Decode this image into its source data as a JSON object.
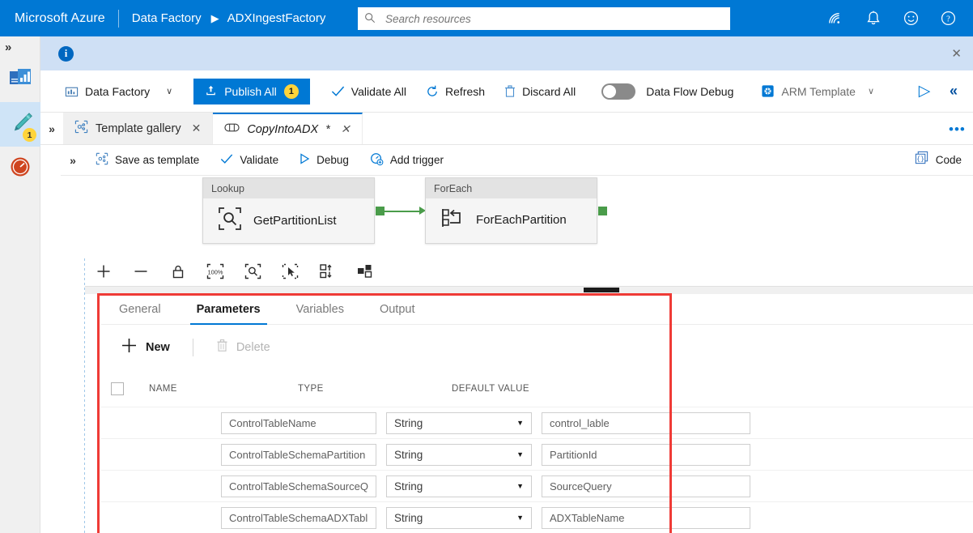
{
  "header": {
    "brand": "Microsoft Azure",
    "breadcrumb_service": "Data Factory",
    "breadcrumb_caret": "▶",
    "breadcrumb_resource": "ADXIngestFactory",
    "search_placeholder": "Search resources",
    "icons": [
      "cloud-shell-icon",
      "notifications-bell-icon",
      "feedback-smiley-icon",
      "help-question-icon"
    ]
  },
  "rail": {
    "expand_glyph": "»",
    "items": [
      {
        "name": "home-overview",
        "badge": ""
      },
      {
        "name": "author-pencil",
        "badge": "1"
      },
      {
        "name": "monitor-gauge",
        "badge": ""
      }
    ]
  },
  "info_bar": {
    "icon": "i",
    "close": "✕"
  },
  "toolbar": {
    "factory_label": "Data Factory",
    "factory_chevron": "∨",
    "publish_label": "Publish All",
    "publish_count": "1",
    "validate_all_label": "Validate All",
    "refresh_label": "Refresh",
    "discard_all_label": "Discard All",
    "data_flow_debug_label": "Data Flow Debug",
    "data_flow_debug_state": "off",
    "arm_template_label": "ARM Template",
    "arm_chevron": "∨",
    "run_glyph": "▷",
    "collapse_glyph": "«"
  },
  "tabs": {
    "expand_glyph": "»",
    "items": [
      {
        "label": "Template gallery",
        "icon": "template-gallery-icon",
        "active": false,
        "dirty": "",
        "close": "✕"
      },
      {
        "label": "CopyIntoADX",
        "icon": "pipeline-icon",
        "active": true,
        "dirty": "*",
        "close": "✕"
      }
    ]
  },
  "pipeline_toolbar": {
    "expand_glyph": "»",
    "save_as_template_label": "Save as template",
    "validate_label": "Validate",
    "debug_label": "Debug",
    "add_trigger_label": "Add trigger",
    "more_glyph": "•••",
    "code_label": "Code"
  },
  "canvas": {
    "activities": [
      {
        "type": "Lookup",
        "name": "GetPartitionList",
        "icon": "lookup-magnifier-icon"
      },
      {
        "type": "ForEach",
        "name": "ForEachPartition",
        "icon": "foreach-loop-icon"
      }
    ],
    "zoom_controls": [
      "zoom-in-icon",
      "zoom-out-icon",
      "lock-icon",
      "zoom-100-percent-icon",
      "zoom-to-fit-icon",
      "select-mode-icon",
      "auto-align-icon",
      "grouping-icon"
    ]
  },
  "properties_panel": {
    "tabs": [
      {
        "label": "General",
        "active": false
      },
      {
        "label": "Parameters",
        "active": true
      },
      {
        "label": "Variables",
        "active": false
      },
      {
        "label": "Output",
        "active": false
      }
    ],
    "new_label": "New",
    "delete_label": "Delete",
    "delete_disabled": true,
    "columns": [
      "NAME",
      "TYPE",
      "DEFAULT VALUE"
    ],
    "rows": [
      {
        "name": "ControlTableName",
        "type": "String",
        "default": "control_lable"
      },
      {
        "name": "ControlTableSchemaPartition",
        "type": "String",
        "default": "PartitionId"
      },
      {
        "name": "ControlTableSchemaSourceQ",
        "type": "String",
        "default": "SourceQuery"
      },
      {
        "name": "ControlTableSchemaADXTabl",
        "type": "String",
        "default": "ADXTableName"
      }
    ]
  },
  "colors": {
    "azure_blue": "#0078d4",
    "highlight_red": "#ef3b36",
    "badge_yellow": "#ffd43b",
    "connector_green": "#4a9c4a"
  }
}
